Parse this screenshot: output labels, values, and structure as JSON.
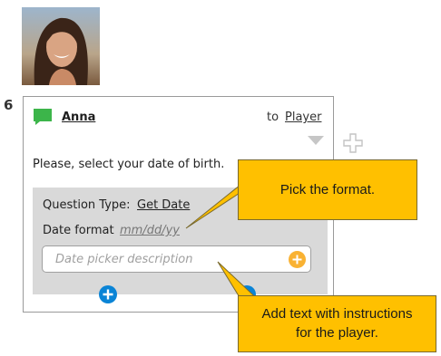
{
  "step": {
    "number": "6"
  },
  "card": {
    "speaker": "Anna",
    "to_label": "to",
    "recipient": "Player",
    "message": "Please, select your date of birth.",
    "question_type_label": "Question Type:",
    "question_type_value": "Get Date",
    "date_format_label": "Date format",
    "date_format_value": "mm/dd/yy",
    "description_placeholder": "Date picker description"
  },
  "callouts": {
    "format": "Pick the format.",
    "instructions_line1": "Add text with instructions",
    "instructions_line2": "for the player."
  },
  "icons": {
    "chat": "speech-bubble-icon",
    "collapse": "triangle-down-icon",
    "outside_add": "plus-outline-icon",
    "input_add": "plus-circle-icon",
    "add_buttons": "plus-circle-icon"
  },
  "colors": {
    "chat_green": "#3cb54a",
    "add_blue": "#0a84d6",
    "input_add_orange": "#f9b233",
    "callout_fill": "#ffc000",
    "config_bg": "#d9d9d9"
  }
}
